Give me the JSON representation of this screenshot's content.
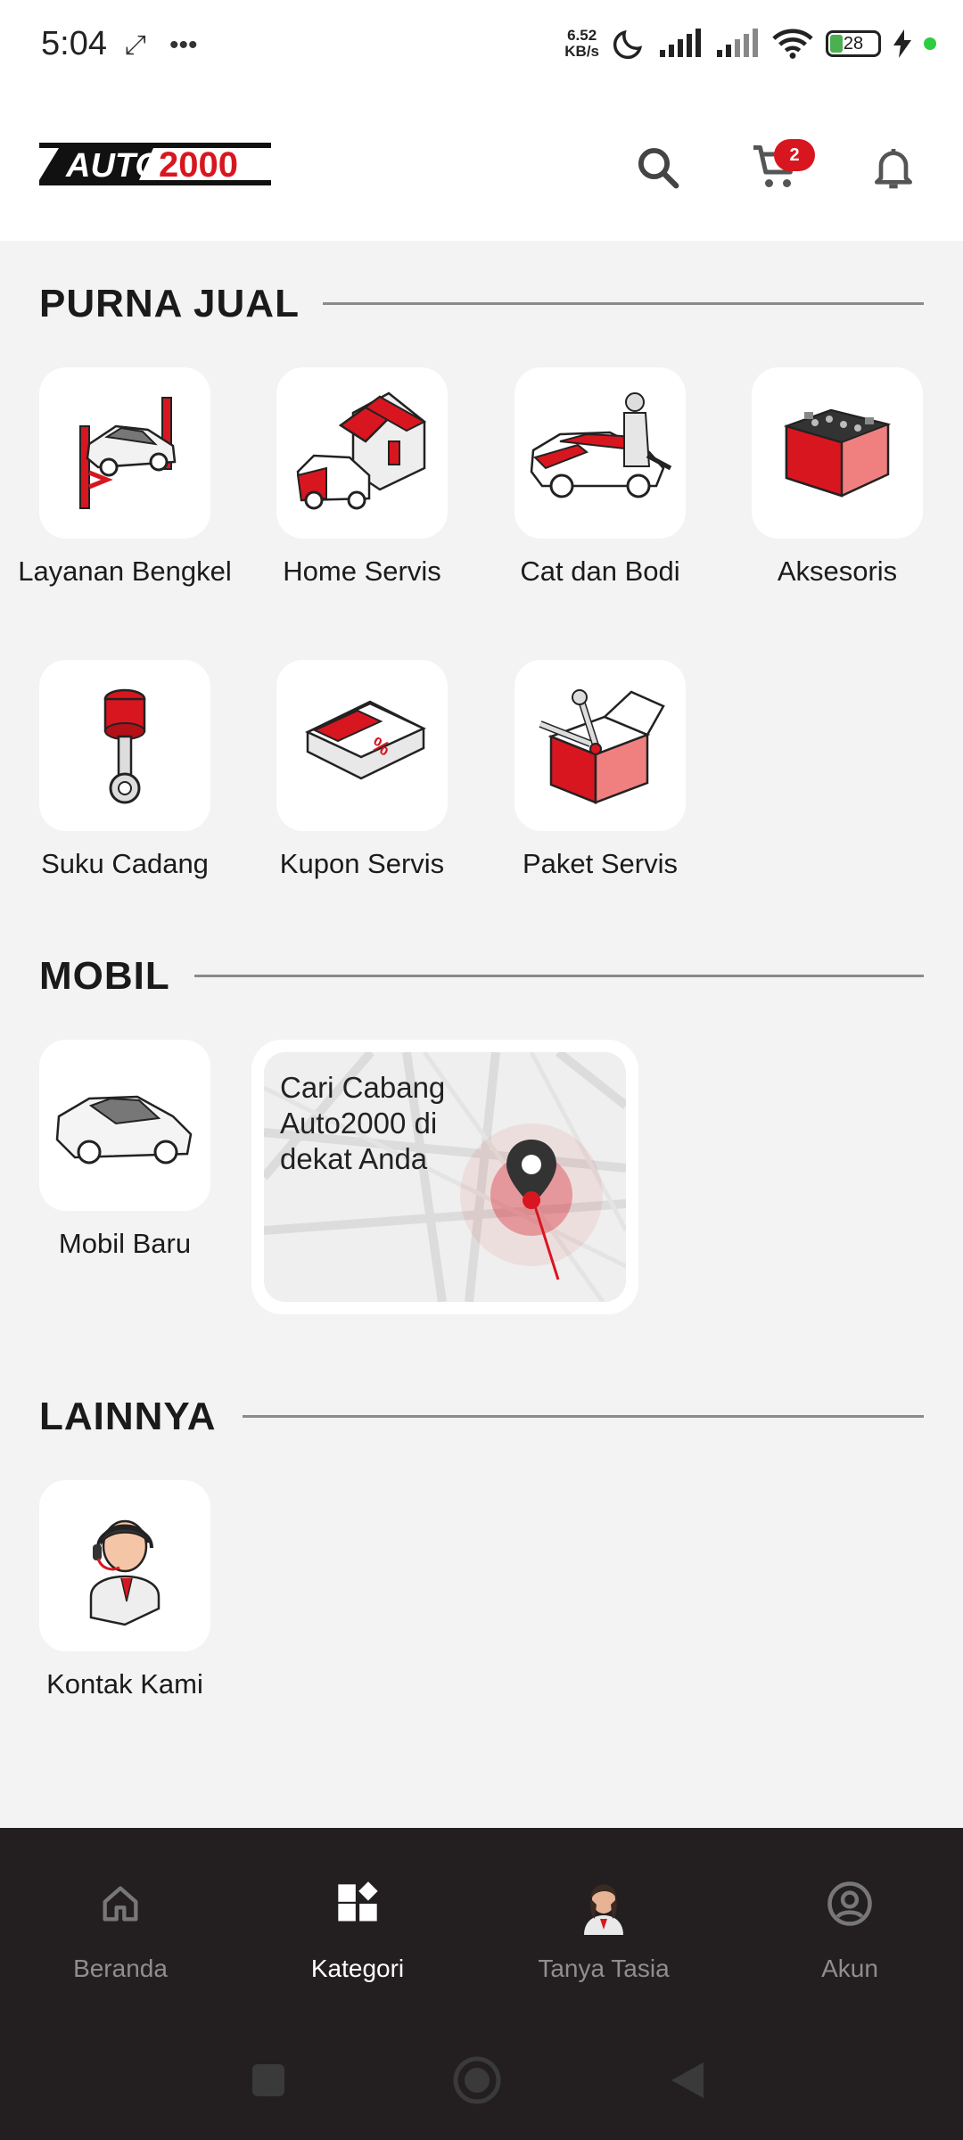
{
  "status_bar": {
    "time": "5:04",
    "net_speed_value": "6.52",
    "net_speed_unit": "KB/s",
    "battery": "28"
  },
  "header": {
    "logo_text": "AUTO 2000",
    "cart_count": "2",
    "icons": [
      "search-icon",
      "cart-icon",
      "bell-icon"
    ]
  },
  "sections": {
    "purna_jual": {
      "title": "PURNA JUAL",
      "items": [
        {
          "label": "Layanan Bengkel"
        },
        {
          "label": "Home Servis"
        },
        {
          "label": "Cat dan Bodi"
        },
        {
          "label": "Aksesoris"
        },
        {
          "label": "Suku Cadang"
        },
        {
          "label": "Kupon Servis"
        },
        {
          "label": "Paket Servis"
        }
      ]
    },
    "mobil": {
      "title": "MOBIL",
      "items": [
        {
          "label": "Mobil Baru"
        }
      ],
      "map_card": {
        "text": "Cari Cabang Auto2000 di dekat Anda"
      }
    },
    "lainnya": {
      "title": "LAINNYA",
      "items": [
        {
          "label": "Kontak Kami"
        }
      ]
    }
  },
  "bottom_nav": {
    "items": [
      {
        "label": "Beranda",
        "icon": "home-icon"
      },
      {
        "label": "Kategori",
        "icon": "category-icon",
        "active": true
      },
      {
        "label": "Tanya Tasia",
        "icon": "assistant-avatar"
      },
      {
        "label": "Akun",
        "icon": "account-icon"
      }
    ]
  },
  "colors": {
    "brand_red": "#d8161f",
    "nav_bg": "#231f20",
    "page_bg": "#f3f3f3"
  }
}
